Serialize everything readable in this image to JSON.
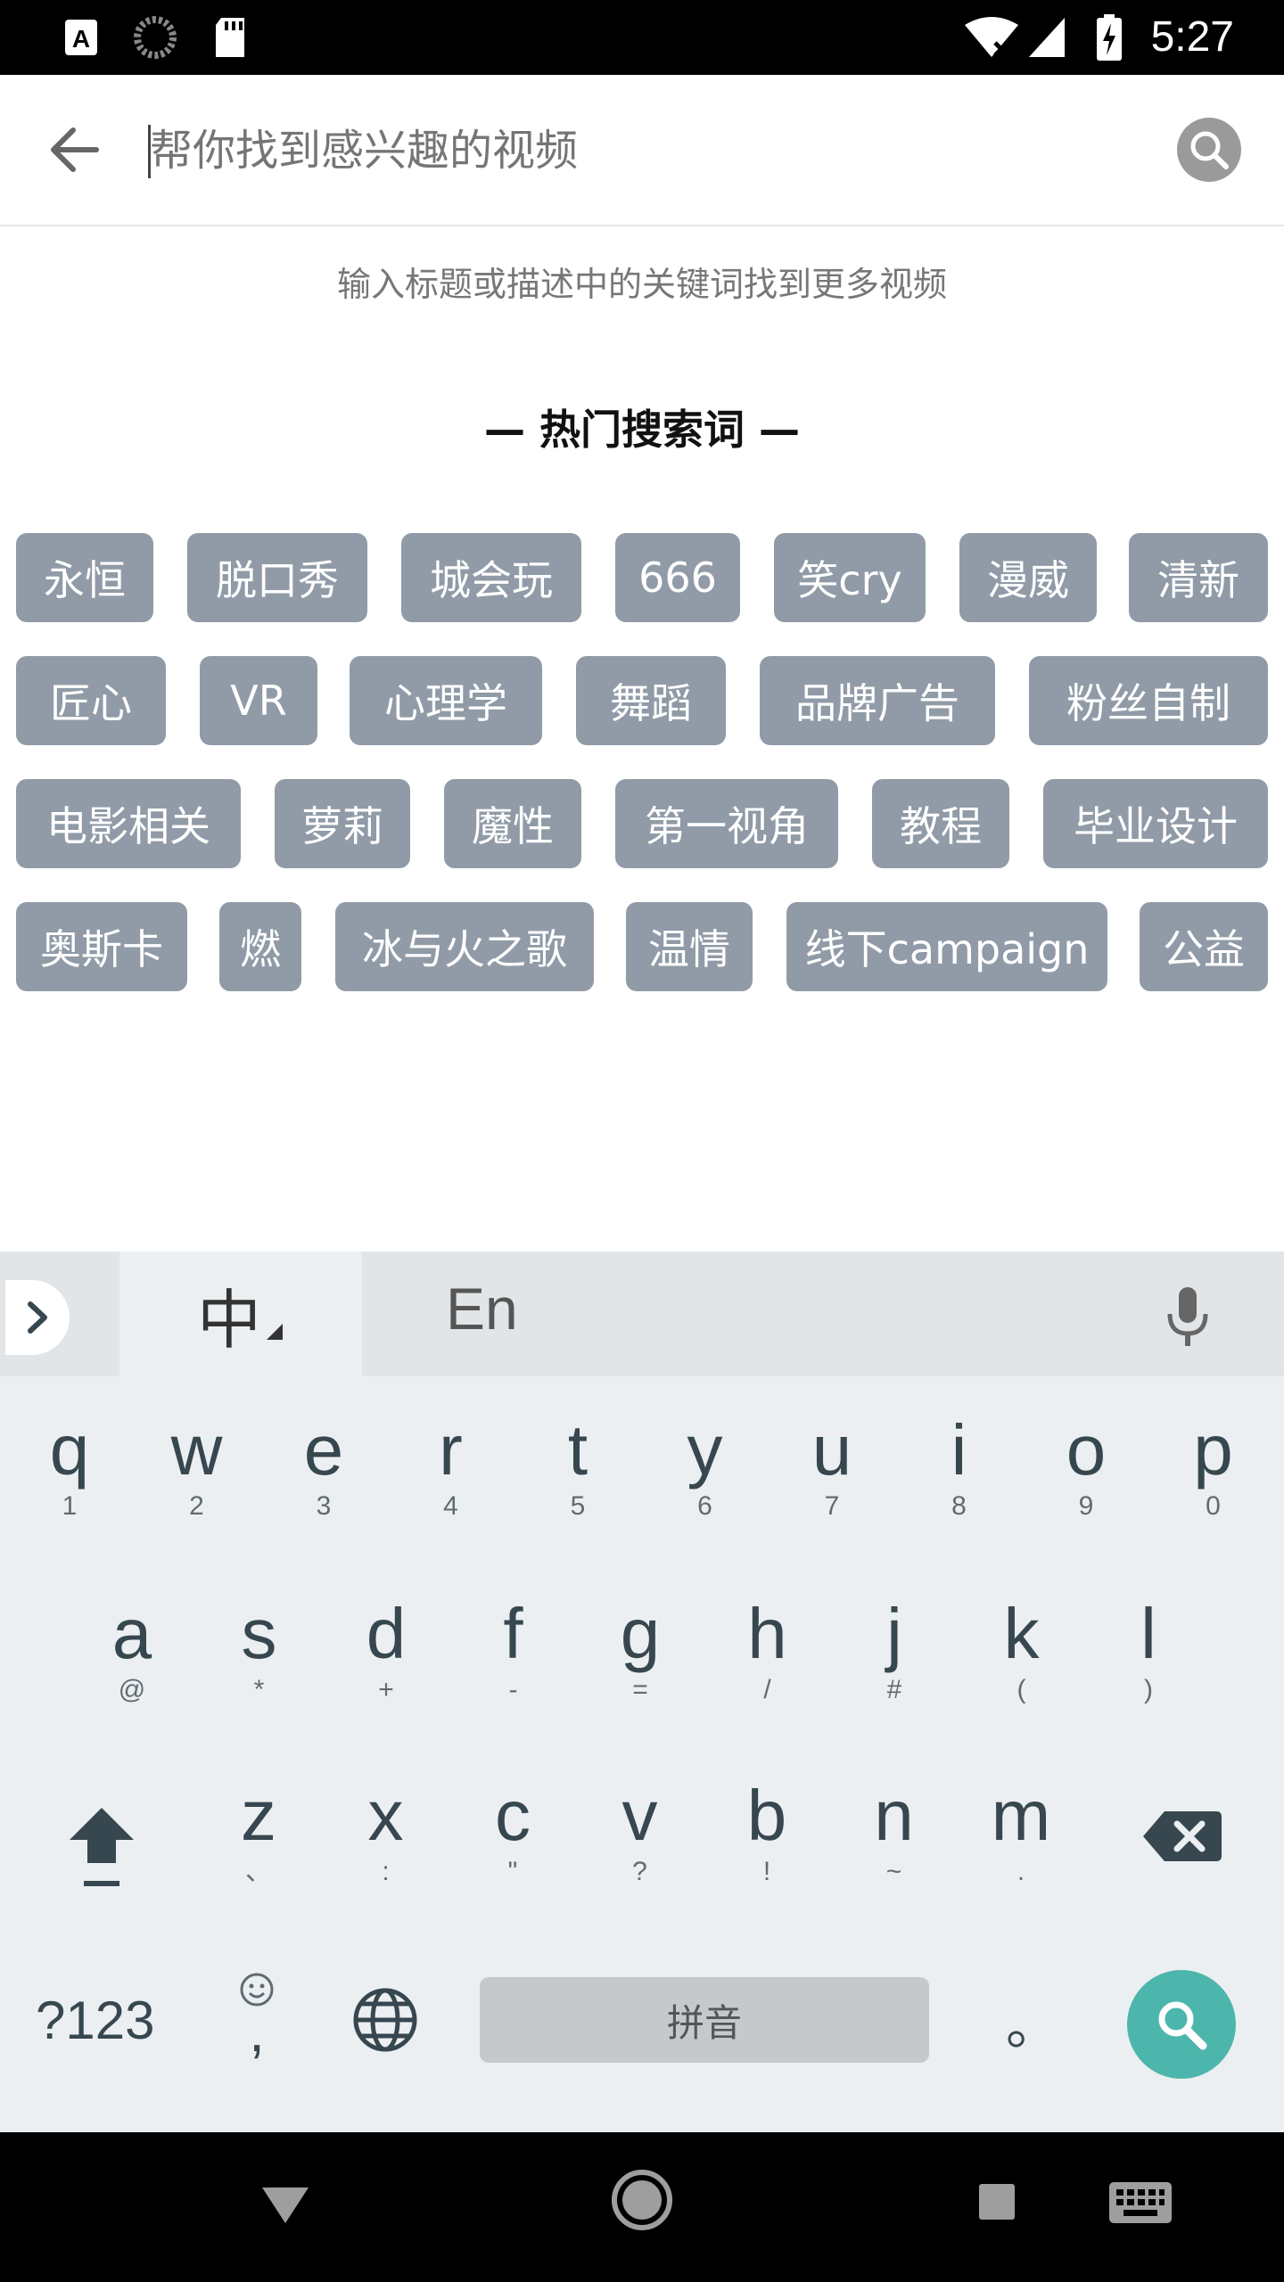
{
  "status_bar": {
    "time": "5:27",
    "icons": [
      "text-a-icon",
      "loading-icon",
      "sd-card-icon",
      "wifi-off-icon",
      "cell-signal-icon",
      "battery-charging-icon"
    ]
  },
  "search": {
    "placeholder": "帮你找到感兴趣的视频",
    "hint": "输入标题或描述中的关键词找到更多视频"
  },
  "hot_section": {
    "title": "— 热门搜索词 —",
    "tags": [
      [
        "永恒",
        "脱口秀",
        "城会玩",
        "666",
        "笑cry",
        "漫威",
        "清新"
      ],
      [
        "匠心",
        "VR",
        "心理学",
        "舞蹈",
        "品牌广告",
        "粉丝自制"
      ],
      [
        "电影相关",
        "萝莉",
        "魔性",
        "第一视角",
        "教程",
        "毕业设计"
      ],
      [
        "奥斯卡",
        "燃",
        "冰与火之歌",
        "温情",
        "线下campaign",
        "公益"
      ]
    ]
  },
  "keyboard": {
    "lang_zh": "中",
    "lang_en": "En",
    "row1": [
      [
        "q",
        "1"
      ],
      [
        "w",
        "2"
      ],
      [
        "e",
        "3"
      ],
      [
        "r",
        "4"
      ],
      [
        "t",
        "5"
      ],
      [
        "y",
        "6"
      ],
      [
        "u",
        "7"
      ],
      [
        "i",
        "8"
      ],
      [
        "o",
        "9"
      ],
      [
        "p",
        "0"
      ]
    ],
    "row2": [
      [
        "a",
        "@"
      ],
      [
        "s",
        "*"
      ],
      [
        "d",
        "+"
      ],
      [
        "f",
        "-"
      ],
      [
        "g",
        "="
      ],
      [
        "h",
        "/"
      ],
      [
        "j",
        "#"
      ],
      [
        "k",
        "("
      ],
      [
        "l",
        ")"
      ]
    ],
    "row3": [
      [
        "z",
        "、"
      ],
      [
        "x",
        ":"
      ],
      [
        "c",
        "\""
      ],
      [
        "v",
        "?"
      ],
      [
        "b",
        "!"
      ],
      [
        "n",
        "~"
      ],
      [
        "m",
        "."
      ]
    ],
    "symbols_key": "?123",
    "comma": ",",
    "space_label": "拼音",
    "period": "。"
  },
  "colors": {
    "tag_bg": "#909ba7",
    "accent_go": "#4db6ac"
  }
}
